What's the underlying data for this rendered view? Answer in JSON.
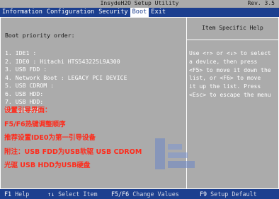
{
  "window": {
    "title": "InsydeH2O Setup Utility",
    "revision": "Rev. 3.5"
  },
  "menu": {
    "items": [
      "Information",
      "Configuration",
      "Security",
      "Boot",
      "Exit"
    ],
    "active": "Boot"
  },
  "boot": {
    "section_title": "Boot priority order:",
    "order": [
      "1. IDE1 :",
      "2. IDE0 : Hitachi HTS543225L9A300",
      "3. USB FDD :",
      "4. Network Boot : LEGACY PCI DEVICE",
      "5. USB CDROM :",
      "6. USB HDD:",
      "7. USB HDD:",
      "8. USB HDD:"
    ]
  },
  "help": {
    "title": "Item Specific Help",
    "lines": [
      "Use <↑> or <↓> to select",
      "a device, then press",
      "<F5> to move it down the",
      "list, or <F6> to move",
      "it up the list. Press",
      "<Esc> to escape the menu"
    ]
  },
  "annotation": {
    "color": "#ff2a1a",
    "lines": [
      "设置引导界面：",
      "F5/F6热键调整顺序",
      "推荐设置IDE0为第一引导设备",
      "附注：USB FDD为USB软驱 USB CDROM",
      "光驱 USB HDD为USB硬盘"
    ]
  },
  "footer": {
    "keys": [
      {
        "key": "F1",
        "desc": "Help"
      },
      {
        "key": "↑↓",
        "desc": "Select Item"
      },
      {
        "key": "F5/F6",
        "desc": "Change Values"
      },
      {
        "key": "F9",
        "desc": "Setup Default"
      }
    ]
  },
  "colors": {
    "menubar": "#1c3f8f",
    "panel_bg": "#ababab",
    "text": "#ffffff"
  }
}
